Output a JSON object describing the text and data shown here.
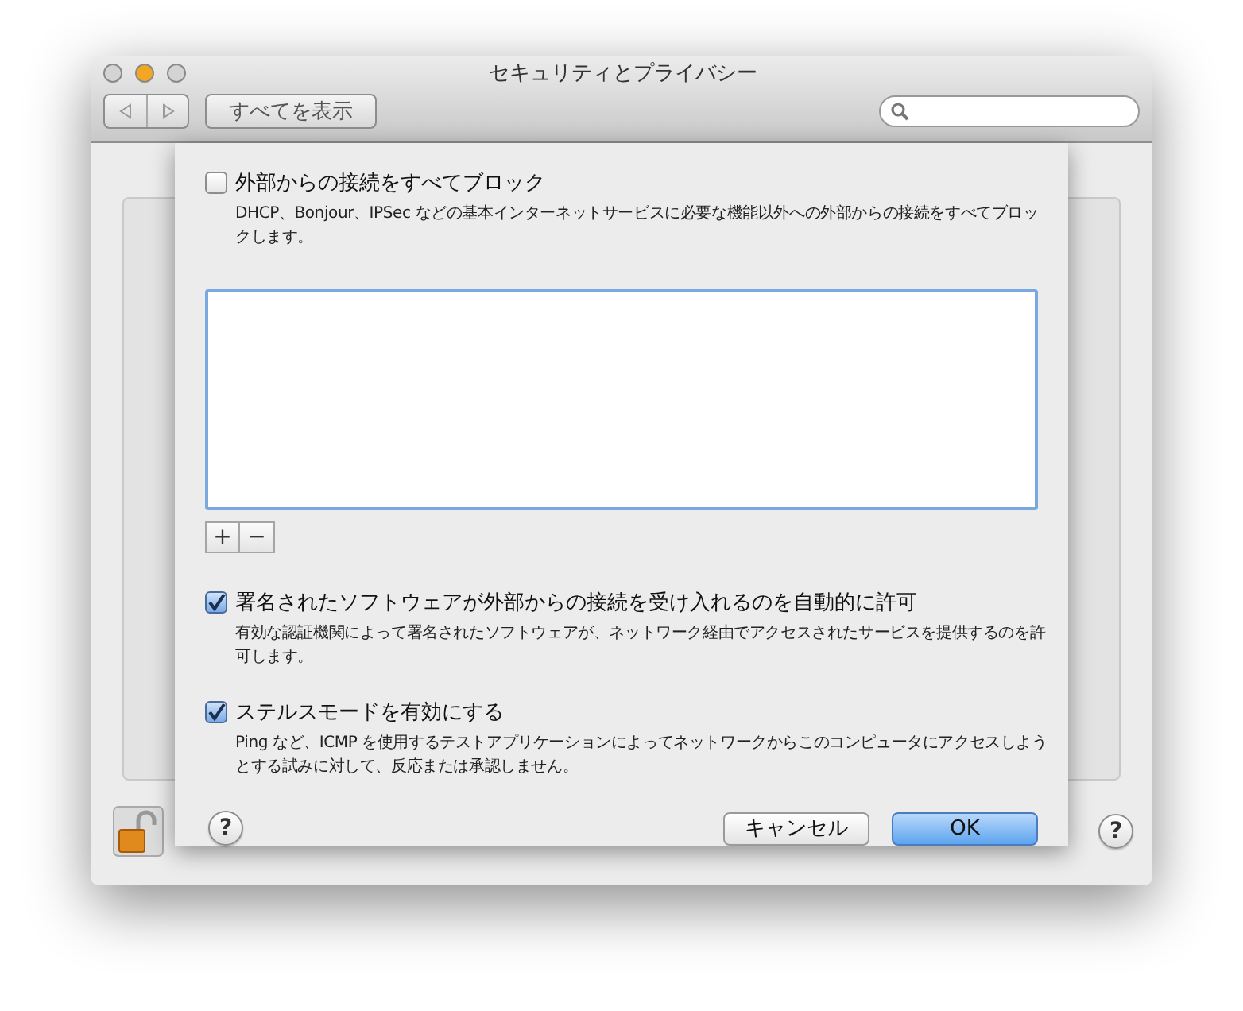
{
  "window": {
    "title": "セキュリティとプライバシー"
  },
  "toolbar": {
    "show_all": "すべてを表示"
  },
  "sheet": {
    "options": [
      {
        "label": "外部からの接続をすべてブロック",
        "description": "DHCP、Bonjour、IPSec などの基本インターネットサービスに必要な機能以外への外部からの接続をすべてブロックします。",
        "checked": false
      },
      {
        "label": "署名されたソフトウェアが外部からの接続を受け入れるのを自動的に許可",
        "description": "有効な認証機関によって署名されたソフトウェアが、ネットワーク経由でアクセスされたサービスを提供するのを許可します。",
        "checked": true
      },
      {
        "label": "ステルスモードを有効にする",
        "description": "Ping など、ICMP を使用するテストアプリケーションによってネットワークからこのコンピュータにアクセスしようとする試みに対して、反応または承認しません。",
        "checked": true
      }
    ],
    "list_buttons": [
      "+",
      "−"
    ],
    "help": "?",
    "buttons": [
      {
        "label": "キャンセル",
        "kind": "cancel"
      },
      {
        "label": "OK",
        "kind": "default"
      }
    ]
  },
  "window_help": "?"
}
